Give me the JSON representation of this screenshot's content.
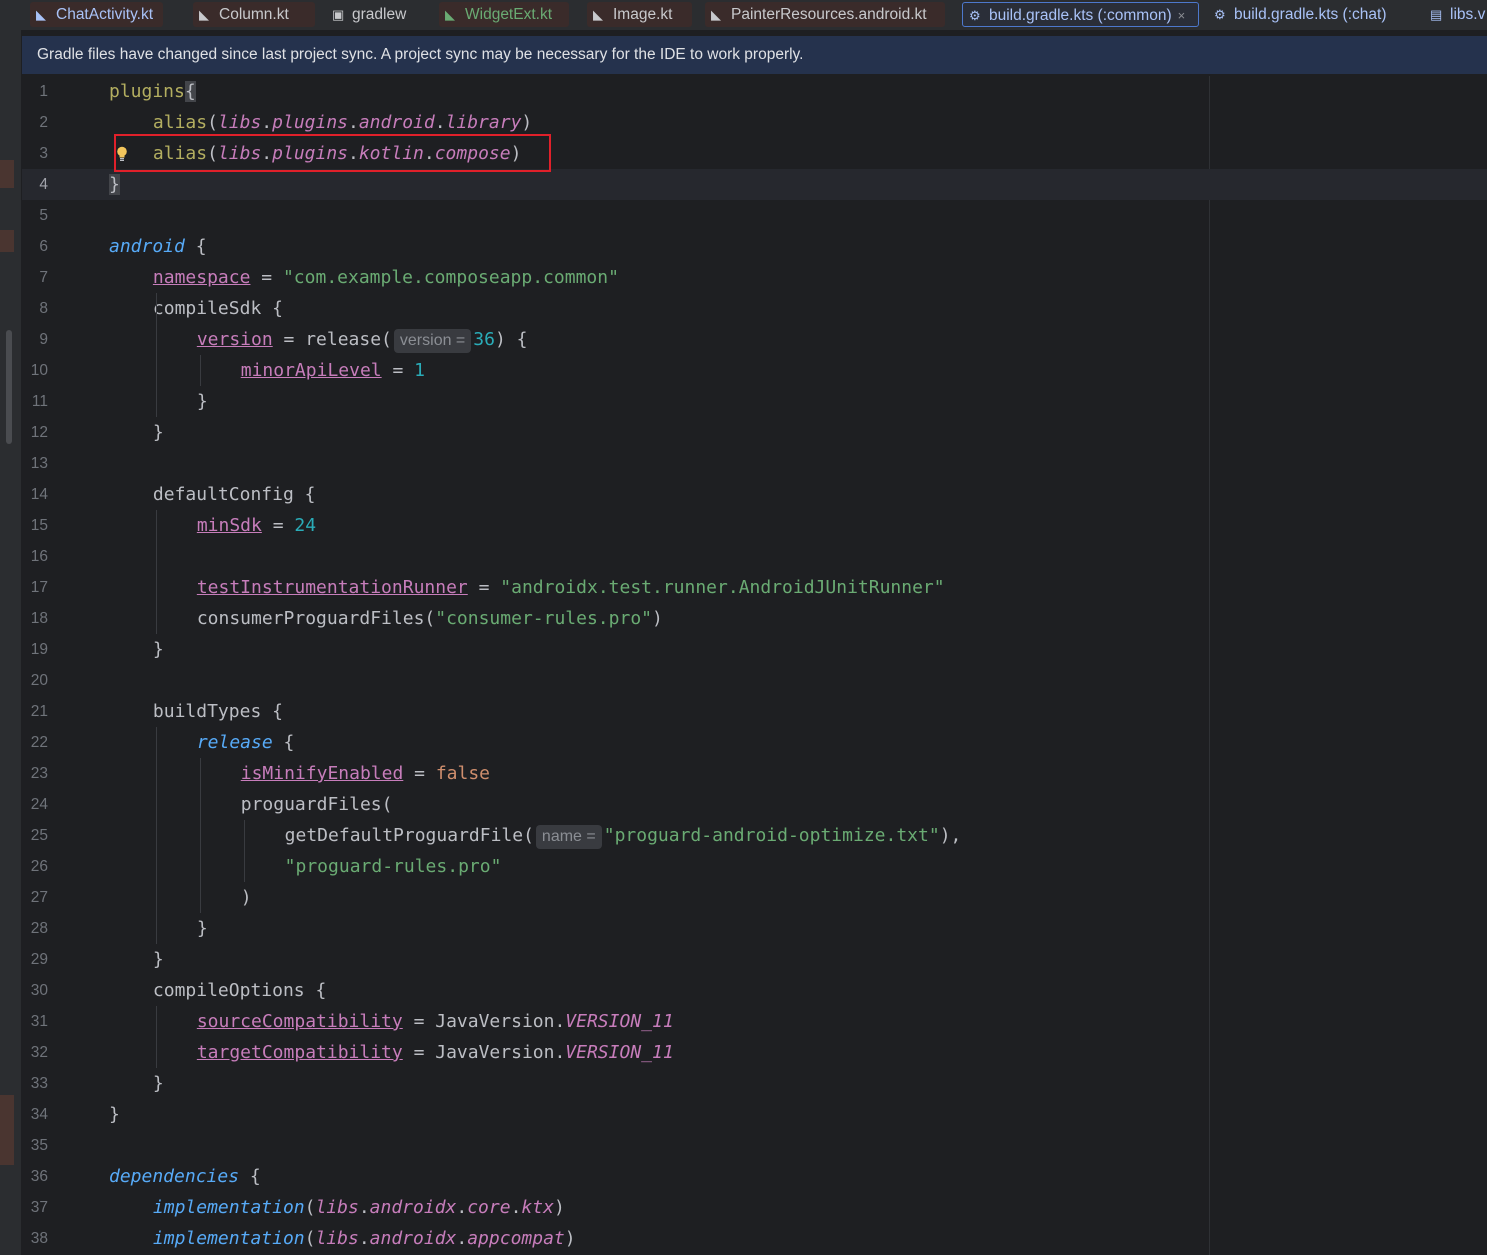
{
  "tabs": [
    {
      "label": "ChatActivity.kt",
      "icon": "kotlin-file-icon",
      "state": "error",
      "color": "#a9c2f7"
    },
    {
      "label": "Column.kt",
      "icon": "kotlin-file-icon",
      "state": "error",
      "color": "#c8c9cc"
    },
    {
      "label": "gradlew",
      "icon": "terminal-file-icon",
      "state": "normal",
      "color": "#c8c9cc"
    },
    {
      "label": "WidgetExt.kt",
      "icon": "kotlin-file-icon",
      "state": "error",
      "color": "#6aab73"
    },
    {
      "label": "Image.kt",
      "icon": "kotlin-file-icon",
      "state": "error",
      "color": "#c8c9cc"
    },
    {
      "label": "PainterResources.android.kt",
      "icon": "kotlin-file-icon",
      "state": "error",
      "color": "#c8c9cc"
    },
    {
      "label": "build.gradle.kts (:common)",
      "icon": "gradle-icon",
      "state": "active",
      "color": "#a9c2f7",
      "close": "×"
    },
    {
      "label": "build.gradle.kts (:chat)",
      "icon": "gradle-icon",
      "state": "normal",
      "color": "#a9c2f7"
    },
    {
      "label": "libs.v",
      "icon": "toml-file-icon",
      "state": "normal",
      "color": "#a9c2f7"
    }
  ],
  "banner": {
    "text": "Gradle files have changed since last project sync. A project sync may be necessary for the IDE to work properly."
  },
  "editor": {
    "current_line": 4,
    "highlighted_line": 3,
    "lines": [
      {
        "n": "1",
        "indent": 0,
        "parts": [
          [
            "dsl",
            "plugins"
          ],
          [
            "",
            "{"
          ]
        ]
      },
      {
        "n": "2",
        "indent": 1,
        "parts": [
          [
            "dsl",
            "alias"
          ],
          [
            "",
            "("
          ],
          [
            "lib",
            "libs"
          ],
          [
            "",
            "."
          ],
          [
            "lib",
            "plugins"
          ],
          [
            "",
            "."
          ],
          [
            "lib",
            "android"
          ],
          [
            "",
            "."
          ],
          [
            "lib",
            "library"
          ],
          [
            "",
            ")"
          ]
        ]
      },
      {
        "n": "3",
        "indent": 1,
        "parts": [
          [
            "dsl",
            "alias"
          ],
          [
            "",
            "("
          ],
          [
            "lib",
            "libs"
          ],
          [
            "",
            "."
          ],
          [
            "lib",
            "plugins"
          ],
          [
            "",
            "."
          ],
          [
            "lib",
            "kotlin"
          ],
          [
            "",
            "."
          ],
          [
            "lib",
            "compose"
          ],
          [
            "",
            ")"
          ]
        ]
      },
      {
        "n": "4",
        "indent": 0,
        "parts": [
          [
            "brace",
            "}"
          ]
        ]
      },
      {
        "n": "5",
        "indent": 0,
        "parts": []
      },
      {
        "n": "6",
        "indent": 0,
        "parts": [
          [
            "fn",
            "android"
          ],
          [
            "",
            " {"
          ]
        ]
      },
      {
        "n": "7",
        "indent": 1,
        "parts": [
          [
            "prop",
            "namespace"
          ],
          [
            "",
            " = "
          ],
          [
            "str",
            "\"com.example.composeapp.common\""
          ]
        ]
      },
      {
        "n": "8",
        "indent": 1,
        "parts": [
          [
            "",
            "compileSdk {"
          ]
        ]
      },
      {
        "n": "9",
        "indent": 2,
        "parts": [
          [
            "prop",
            "version"
          ],
          [
            "",
            " = release("
          ],
          [
            "hint",
            "version ="
          ],
          [
            "num",
            "36"
          ],
          [
            "",
            ") {"
          ]
        ]
      },
      {
        "n": "10",
        "indent": 3,
        "parts": [
          [
            "prop",
            "minorApiLevel"
          ],
          [
            "",
            " = "
          ],
          [
            "num",
            "1"
          ]
        ]
      },
      {
        "n": "11",
        "indent": 2,
        "parts": [
          [
            "",
            "}"
          ]
        ]
      },
      {
        "n": "12",
        "indent": 1,
        "parts": [
          [
            "",
            "}"
          ]
        ]
      },
      {
        "n": "13",
        "indent": 0,
        "parts": []
      },
      {
        "n": "14",
        "indent": 1,
        "parts": [
          [
            "",
            "defaultConfig {"
          ]
        ]
      },
      {
        "n": "15",
        "indent": 2,
        "parts": [
          [
            "prop",
            "minSdk"
          ],
          [
            "",
            " = "
          ],
          [
            "num",
            "24"
          ]
        ]
      },
      {
        "n": "16",
        "indent": 0,
        "parts": []
      },
      {
        "n": "17",
        "indent": 2,
        "parts": [
          [
            "prop",
            "testInstrumentationRunner"
          ],
          [
            "",
            " = "
          ],
          [
            "str",
            "\"androidx.test.runner.AndroidJUnitRunner\""
          ]
        ]
      },
      {
        "n": "18",
        "indent": 2,
        "parts": [
          [
            "",
            "consumerProguardFiles("
          ],
          [
            "str",
            "\"consumer-rules.pro\""
          ],
          [
            "",
            ")"
          ]
        ]
      },
      {
        "n": "19",
        "indent": 1,
        "parts": [
          [
            "",
            "}"
          ]
        ]
      },
      {
        "n": "20",
        "indent": 0,
        "parts": []
      },
      {
        "n": "21",
        "indent": 1,
        "parts": [
          [
            "",
            "buildTypes {"
          ]
        ]
      },
      {
        "n": "22",
        "indent": 2,
        "parts": [
          [
            "fn",
            "release"
          ],
          [
            "",
            " {"
          ]
        ]
      },
      {
        "n": "23",
        "indent": 3,
        "parts": [
          [
            "prop",
            "isMinifyEnabled"
          ],
          [
            "",
            " = "
          ],
          [
            "kw",
            "false"
          ]
        ]
      },
      {
        "n": "24",
        "indent": 3,
        "parts": [
          [
            "",
            "proguardFiles("
          ]
        ]
      },
      {
        "n": "25",
        "indent": 4,
        "parts": [
          [
            "",
            "getDefaultProguardFile("
          ],
          [
            "hint",
            "name ="
          ],
          [
            "str",
            "\"proguard-android-optimize.txt\""
          ],
          [
            "",
            "),"
          ]
        ]
      },
      {
        "n": "26",
        "indent": 4,
        "parts": [
          [
            "str",
            "\"proguard-rules.pro\""
          ]
        ]
      },
      {
        "n": "27",
        "indent": 3,
        "parts": [
          [
            "",
            ")"
          ]
        ]
      },
      {
        "n": "28",
        "indent": 2,
        "parts": [
          [
            "",
            "}"
          ]
        ]
      },
      {
        "n": "29",
        "indent": 1,
        "parts": [
          [
            "",
            "}"
          ]
        ]
      },
      {
        "n": "30",
        "indent": 1,
        "parts": [
          [
            "",
            "compileOptions {"
          ]
        ]
      },
      {
        "n": "31",
        "indent": 2,
        "parts": [
          [
            "prop",
            "sourceCompatibility"
          ],
          [
            "",
            " = JavaVersion."
          ],
          [
            "lib",
            "VERSION_11"
          ]
        ]
      },
      {
        "n": "32",
        "indent": 2,
        "parts": [
          [
            "prop",
            "targetCompatibility"
          ],
          [
            "",
            " = JavaVersion."
          ],
          [
            "lib",
            "VERSION_11"
          ]
        ]
      },
      {
        "n": "33",
        "indent": 1,
        "parts": [
          [
            "",
            "}"
          ]
        ]
      },
      {
        "n": "34",
        "indent": 0,
        "parts": [
          [
            "",
            "}"
          ]
        ]
      },
      {
        "n": "35",
        "indent": 0,
        "parts": []
      },
      {
        "n": "36",
        "indent": 0,
        "parts": [
          [
            "fn",
            "dependencies"
          ],
          [
            "",
            " {"
          ]
        ]
      },
      {
        "n": "37",
        "indent": 1,
        "parts": [
          [
            "fn",
            "implementation"
          ],
          [
            "",
            "("
          ],
          [
            "lib",
            "libs"
          ],
          [
            "",
            "."
          ],
          [
            "lib",
            "androidx"
          ],
          [
            "",
            "."
          ],
          [
            "lib",
            "core"
          ],
          [
            "",
            "."
          ],
          [
            "lib",
            "ktx"
          ],
          [
            "",
            ")"
          ]
        ]
      },
      {
        "n": "38",
        "indent": 1,
        "parts": [
          [
            "fn",
            "implementation"
          ],
          [
            "",
            "("
          ],
          [
            "lib",
            "libs"
          ],
          [
            "",
            "."
          ],
          [
            "lib",
            "androidx"
          ],
          [
            "",
            "."
          ],
          [
            "lib",
            "appcompat"
          ],
          [
            "",
            ")"
          ]
        ]
      }
    ]
  }
}
